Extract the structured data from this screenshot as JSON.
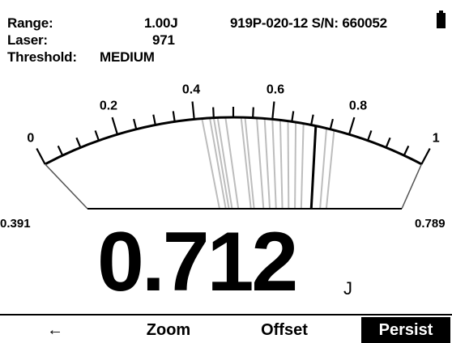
{
  "header": {
    "range_label": "Range:",
    "range_value": "1.00J",
    "laser_label": "Laser:",
    "laser_value": "971",
    "threshold_label": "Threshold:",
    "threshold_value": "MEDIUM",
    "device": "919P-020-12 S/N: 660052",
    "battery_level": 1.0
  },
  "gauge": {
    "scale_labels": [
      "0",
      "0.2",
      "0.4",
      "0.6",
      "0.8",
      "1"
    ],
    "scale_min": 0,
    "scale_max": 1,
    "current_value": 0.712,
    "history_values": [
      0.42,
      0.44,
      0.45,
      0.46,
      0.48,
      0.52,
      0.53,
      0.56,
      0.58,
      0.6,
      0.62,
      0.64,
      0.66,
      0.68,
      0.74,
      0.76
    ],
    "zoom_min": 0.391,
    "zoom_max": 0.789
  },
  "reading": {
    "value": "0.712",
    "unit": "J"
  },
  "softkeys": {
    "back_icon": "left-arrow-icon",
    "back_glyph": "←",
    "zoom": "Zoom",
    "offset": "Offset",
    "persist": "Persist"
  },
  "colors": {
    "needle": "#000000",
    "history": "#bdbdbd",
    "active_softkey_bg": "#000000"
  }
}
